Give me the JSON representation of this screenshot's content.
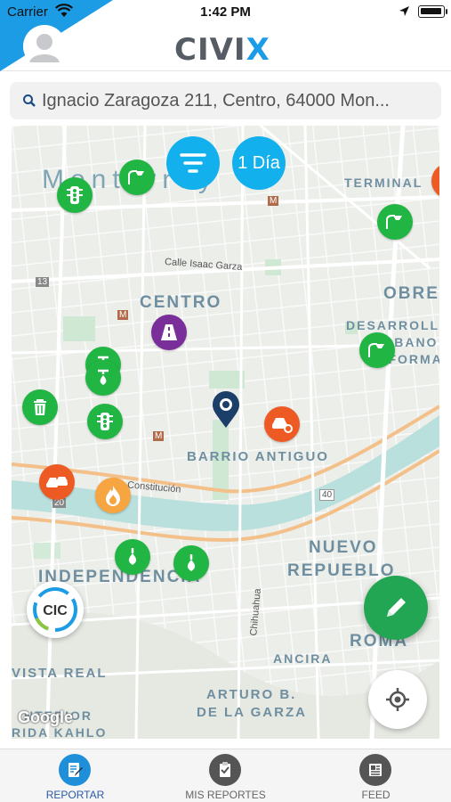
{
  "status_bar": {
    "carrier": "Carrier",
    "time": "1:42 PM"
  },
  "header": {
    "logo_text": "CIVI",
    "logo_accent": "X"
  },
  "search": {
    "value": "Ignacio Zaragoza 211, Centro, 64000 Mon..."
  },
  "map": {
    "labels": {
      "monterrey": "Monterrey",
      "terminal": "TERMINAL",
      "centro": "CENTRO",
      "obrera": "OBRE",
      "desarrollo_1": "DESARROLLO",
      "desarrollo_2": "URBANO",
      "desarrollo_3": "REFORMA",
      "barrio_antiguo": "BARRIO ANTIGUO",
      "nuevo_repueblo_1": "NUEVO",
      "nuevo_repueblo_2": "REPUEBLO",
      "independencia": "INDEPENDENCIA",
      "roma": "ROMA",
      "ancira": "ANCIRA",
      "vista_real": "VISTA REAL",
      "arturo_1": "ARTURO B.",
      "arturo_2": "DE LA GARZA",
      "frida_1": "NTERIOR",
      "frida_2": "RIDA KAHLO",
      "calle_isaac": "Calle Isaac Garza",
      "constitucion": "Constitución",
      "chihuahua": "Chihuahua",
      "route_13": "13",
      "route_20": "20",
      "route_40": "40",
      "metro": "M"
    },
    "attribution": "Google"
  },
  "controls": {
    "day_filter": "1 Día",
    "cic_label": "CIC"
  },
  "tabs": [
    {
      "label": "REPORTAR",
      "active": true
    },
    {
      "label": "MIS REPORTES",
      "active": false
    },
    {
      "label": "FEED",
      "active": false
    }
  ],
  "colors": {
    "brand_blue": "#1d9ce6",
    "report_green": "#21b543",
    "report_orange": "#ee5a24",
    "report_purple": "#7a2e99",
    "edit_green": "#22a653",
    "tab_active": "#2a5aa8"
  }
}
